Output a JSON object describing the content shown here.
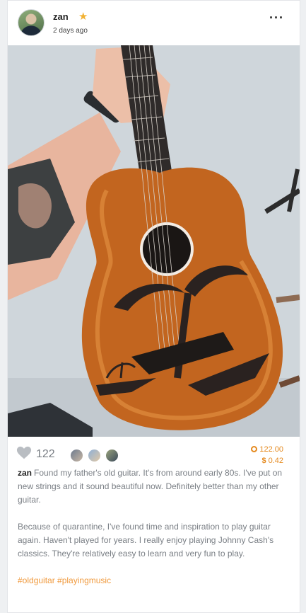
{
  "post": {
    "username": "zan",
    "time": "2 days ago",
    "more_label": "···",
    "likes": "122",
    "reward_coins": "122.00",
    "reward_dollars": "0.42",
    "reward_dollar_sign": "$",
    "caption_author": "zan",
    "caption_p1": "Found my father's old guitar. It's from around early 80s. I've put on new strings and it sound beautiful now. Definitely better than my other guitar.",
    "caption_p2": "Because of quarantine, I've found time and inspiration to play guitar again. Haven't played for years. I really enjoy playing Johnny Cash's classics. They're relatively easy to learn and very fun to play.",
    "hashtags": "#oldguitar #playingmusic"
  },
  "icons": {
    "star": "star-icon",
    "heart": "heart-icon",
    "coin": "coin-icon",
    "more": "more-icon"
  },
  "colors": {
    "accent": "#f09a3e",
    "reward": "#e58a1f",
    "text": "#7a7f85"
  }
}
